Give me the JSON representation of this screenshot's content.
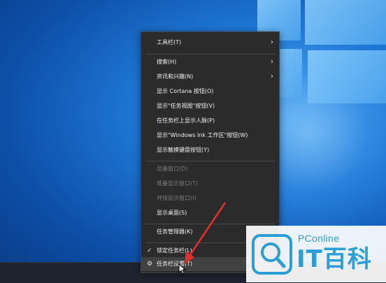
{
  "menu": {
    "items": [
      {
        "label": "工具栏(T)",
        "chevron": true
      },
      {
        "label": "搜索(H)",
        "chevron": true
      },
      {
        "label": "资讯和兴趣(N)",
        "chevron": true
      },
      {
        "label": "显示 Cortana 按钮(O)"
      },
      {
        "label": "显示\"任务视图\"按钮(V)"
      },
      {
        "label": "在任务栏上显示人脉(P)"
      },
      {
        "label": "显示\"Windows Ink 工作区\"按钮(W)"
      },
      {
        "label": "显示触摸键盘按钮(Y)"
      },
      {
        "label": "层叠窗口(D)",
        "disabled": true
      },
      {
        "label": "堆叠显示窗口(T)",
        "disabled": true
      },
      {
        "label": "并排显示窗口(I)",
        "disabled": true
      },
      {
        "label": "显示桌面(S)"
      },
      {
        "label": "任务管理器(K)"
      },
      {
        "label": "锁定任务栏(L)",
        "checked": true
      },
      {
        "label": "任务栏设置(T)",
        "icon": "gear-icon",
        "highlighted": true
      }
    ]
  },
  "watermark": {
    "brand_top": "PConline",
    "brand_main": "IT百科",
    "icon": "search-magnifier-icon"
  },
  "colors": {
    "menu_bg": "#2b2b2b",
    "highlight": "#414141",
    "arrow": "#e0312b",
    "watermark_blue": "#2a9fd6"
  }
}
